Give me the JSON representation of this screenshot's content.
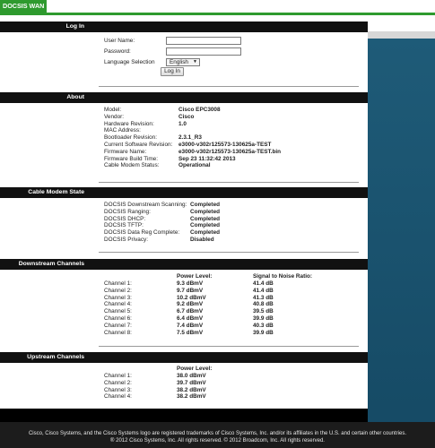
{
  "header": {
    "tab_label": "DOCSIS WAN"
  },
  "login": {
    "section_title": "Log In",
    "username_label": "User Name:",
    "username_value": "",
    "password_label": "Password:",
    "password_value": "",
    "language_label": "Language Selection",
    "language_selected": "English",
    "login_button": "Log In"
  },
  "about": {
    "section_title": "About",
    "fields": [
      {
        "label": "Model:",
        "value": "Cisco EPC3008"
      },
      {
        "label": "Vendor:",
        "value": "Cisco"
      },
      {
        "label": "Hardware Revision:",
        "value": "1.0"
      },
      {
        "label": "MAC Address:",
        "value": ""
      },
      {
        "label": "Bootloader Revision:",
        "value": "2.3.1_R3"
      },
      {
        "label": "Current Software Revision:",
        "value": "e3000-v302r125573-130625a-TEST"
      },
      {
        "label": "Firmware Name:",
        "value": "e3000-v302r125573-130625a-TEST.bin"
      },
      {
        "label": "Firmware Build Time:",
        "value": "Sep 23 11:32:42 2013"
      },
      {
        "label": "Cable Modem Status:",
        "value": "Operational"
      }
    ]
  },
  "cable_modem_state": {
    "section_title": "Cable Modem State",
    "fields": [
      {
        "label": "DOCSIS Downstream Scanning:",
        "value": "Completed"
      },
      {
        "label": "DOCSIS Ranging:",
        "value": "Completed"
      },
      {
        "label": "DOCSIS DHCP:",
        "value": "Completed"
      },
      {
        "label": "DOCSIS TFTP:",
        "value": "Completed"
      },
      {
        "label": "DOCSIS Data Reg Complete:",
        "value": "Completed"
      },
      {
        "label": "DOCSIS Privacy:",
        "value": "Disabled"
      }
    ]
  },
  "downstream": {
    "section_title": "Downstream Channels",
    "col_power": "Power Level:",
    "col_snr": "Signal to Noise Ratio:",
    "rows": [
      {
        "channel": "Channel 1:",
        "power": "9.3 dBmV",
        "snr": "41.4 dB"
      },
      {
        "channel": "Channel 2:",
        "power": "9.7 dBmV",
        "snr": "41.4 dB"
      },
      {
        "channel": "Channel 3:",
        "power": "10.2 dBmV",
        "snr": "41.3 dB"
      },
      {
        "channel": "Channel 4:",
        "power": "9.2 dBmV",
        "snr": "40.8 dB"
      },
      {
        "channel": "Channel 5:",
        "power": "6.7 dBmV",
        "snr": "39.5 dB"
      },
      {
        "channel": "Channel 6:",
        "power": "6.4 dBmV",
        "snr": "39.9 dB"
      },
      {
        "channel": "Channel 7:",
        "power": "7.4 dBmV",
        "snr": "40.3 dB"
      },
      {
        "channel": "Channel 8:",
        "power": "7.5 dBmV",
        "snr": "39.9 dB"
      }
    ]
  },
  "upstream": {
    "section_title": "Upstream Channels",
    "col_power": "Power Level:",
    "rows": [
      {
        "channel": "Channel 1:",
        "power": "38.0 dBmV"
      },
      {
        "channel": "Channel 2:",
        "power": "39.7 dBmV"
      },
      {
        "channel": "Channel 3:",
        "power": "38.2 dBmV"
      },
      {
        "channel": "Channel 4:",
        "power": "38.2 dBmV"
      }
    ]
  },
  "footer": {
    "line1": "Cisco, Cisco Systems, and the Cisco Systems logo are registered trademarks of Cisco Systems, Inc. and/or its affiliates in the U.S. and certain other countries.",
    "line2": "® 2012 Cisco Systems, Inc. All rights reserved. © 2012 Broadcom, Inc. All rights reserved."
  }
}
